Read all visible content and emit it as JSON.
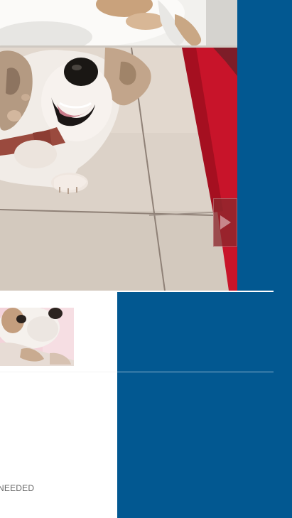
{
  "gallery": {
    "next_icon": "chevron-right-icon",
    "accent_color": "#cc1f2b"
  },
  "listing": {
    "status_text": "NEEDED"
  },
  "colors": {
    "page_background": "#025891",
    "panel_background": "#ffffff"
  }
}
